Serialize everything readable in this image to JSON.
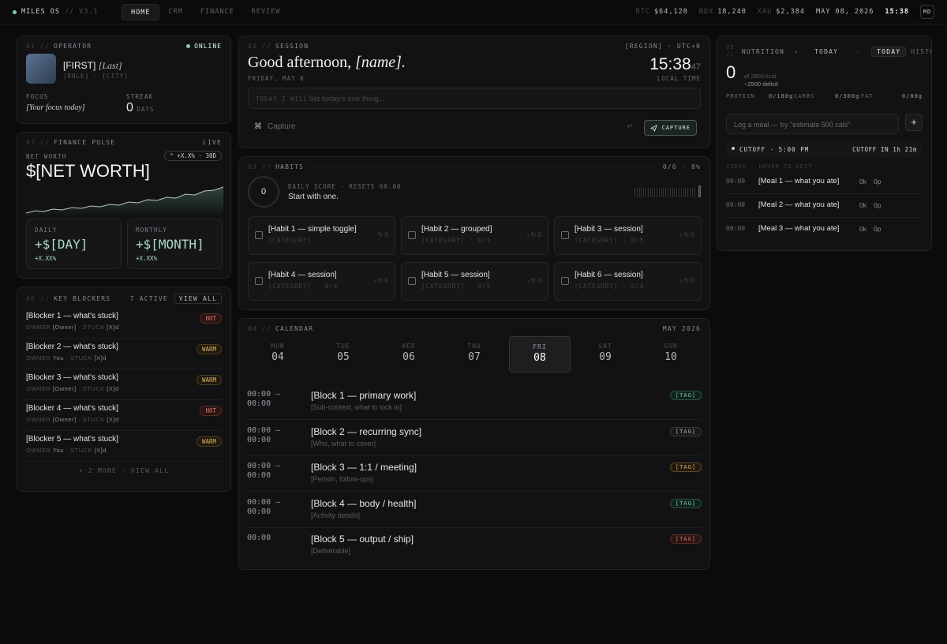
{
  "topbar": {
    "brand": "MILES OS",
    "version": "// V3.1",
    "tabs": [
      "HOME",
      "CRM",
      "FINANCE",
      "REVIEW"
    ],
    "active_tab": "HOME",
    "tickers": [
      {
        "sym": "BTC",
        "value": "$64,120"
      },
      {
        "sym": "NDX",
        "value": "18,240"
      },
      {
        "sym": "XAU",
        "value": "$2,384"
      }
    ],
    "date": "MAY 08, 2026",
    "time": "15:38",
    "user_initials": "MD"
  },
  "operator": {
    "num": "01 //",
    "title": "OPERATOR",
    "status": "ONLINE",
    "first": "[FIRST]",
    "last": "[Last]",
    "role_city": "[ROLE] · [CITY]",
    "focus_label": "FOCUS",
    "focus_value": "[Your focus today]",
    "streak_label": "STREAK",
    "streak_value": "0",
    "streak_unit": "DAYS"
  },
  "finance": {
    "num": "07 //",
    "title": "FINANCE PULSE",
    "live": "LIVE",
    "networth_label": "NET WORTH",
    "networth_value": "$[NET WORTH]",
    "change_badge": "^ +X.X% · 30D",
    "daily_label": "DAILY",
    "daily_value": "+$[DAY]",
    "daily_pct": "+X.XX%",
    "monthly_label": "MONTHLY",
    "monthly_value": "+$[MONTH]",
    "monthly_pct": "+X.XX%"
  },
  "blockers": {
    "num": "06 //",
    "title": "KEY BLOCKERS",
    "active": "7 ACTIVE",
    "view_all": "VIEW ALL",
    "more": "+ 2 MORE · VIEW ALL",
    "owner_label": "OWNER",
    "stuck_label": "· STUCK",
    "items": [
      {
        "title": "[Blocker 1 — what's stuck]",
        "owner": "[Owner]",
        "stuck": "[X]d",
        "tag": "HOT"
      },
      {
        "title": "[Blocker 2 — what's stuck]",
        "owner": "You",
        "stuck": "[X]d",
        "tag": "WARM"
      },
      {
        "title": "[Blocker 3 — what's stuck]",
        "owner": "[Owner]",
        "stuck": "[X]d",
        "tag": "WARM"
      },
      {
        "title": "[Blocker 4 — what's stuck]",
        "owner": "[Owner]",
        "stuck": "[X]d",
        "tag": "HOT"
      },
      {
        "title": "[Blocker 5 — what's stuck]",
        "owner": "You",
        "stuck": "[X]d",
        "tag": "WARM"
      }
    ]
  },
  "session": {
    "num": "02 //",
    "title": "SESSION",
    "region": "[REGION] · UTC+0",
    "greeting": "Good afternoon,",
    "name": "[name].",
    "date": "FRIDAY, MAY 8",
    "time_hm": "15:38",
    "time_s": "47",
    "local_time": "LOCAL TIME",
    "will_label": "TODAY I WILL",
    "will_placeholder": "Set today's one thing...",
    "capture_icon": "⌘",
    "capture_placeholder": "Capture",
    "capture_button": "CAPTURE"
  },
  "habits": {
    "num": "03 //",
    "title": "HABITS",
    "count": "0/6 · 0%",
    "score": "0",
    "score_label": "DAILY SCORE · RESETS 00:00",
    "score_hint": "Start with one.",
    "items": [
      {
        "title": "[Habit 1 — simple toggle]",
        "cat": "[CATEGORY]",
        "meta": "↻ 0"
      },
      {
        "title": "[Habit 2 — grouped]",
        "cat": "[CATEGORY] · 0/3",
        "meta": "› ↻ 0"
      },
      {
        "title": "[Habit 3 — session]",
        "cat": "[CATEGORY] · 0/5",
        "meta": "› ↻ 0"
      },
      {
        "title": "[Habit 4 — session]",
        "cat": "[CATEGORY] · 0/4",
        "meta": "› ↻ 0"
      },
      {
        "title": "[Habit 5 — session]",
        "cat": "[CATEGORY] · 0/5",
        "meta": "› ↻ 0"
      },
      {
        "title": "[Habit 6 — session]",
        "cat": "[CATEGORY] · 0/4",
        "meta": "› ↻ 0"
      }
    ]
  },
  "calendar": {
    "num": "04 //",
    "title": "CALENDAR",
    "month": "MAY 2026",
    "days": [
      {
        "dn": "MON",
        "dd": "04"
      },
      {
        "dn": "TUE",
        "dd": "05"
      },
      {
        "dn": "WED",
        "dd": "06"
      },
      {
        "dn": "THU",
        "dd": "07"
      },
      {
        "dn": "FRI",
        "dd": "08"
      },
      {
        "dn": "SAT",
        "dd": "09"
      },
      {
        "dn": "SUN",
        "dd": "10"
      }
    ],
    "selected_day": 4,
    "events": [
      {
        "time": "00:00 —\n00:00",
        "title": "[Block 1 — primary work]",
        "sub": "[Sub-context, what to lock in]",
        "tag": "[TAG]",
        "tag_color": "green"
      },
      {
        "time": "00:00 —\n00:00",
        "title": "[Block 2 — recurring sync]",
        "sub": "[Who, what to cover]",
        "tag": "[TAG]",
        "tag_color": "gray"
      },
      {
        "time": "00:00 —\n00:00",
        "title": "[Block 3 — 1:1 / meeting]",
        "sub": "[Person, follow-ups]",
        "tag": "[TAG]",
        "tag_color": "amber"
      },
      {
        "time": "00:00 —\n00:00",
        "title": "[Block 4 — body / health]",
        "sub": "[Activity details]",
        "tag": "[TAG]",
        "tag_color": "green"
      },
      {
        "time": "00:00",
        "title": "[Block 5 — output / ship]",
        "sub": "[Deliverable]",
        "tag": "[TAG]",
        "tag_color": "red"
      }
    ]
  },
  "nutrition": {
    "num": "05 //",
    "title": "NUTRITION",
    "prev": "‹",
    "today_nav": "TODAY",
    "sep": "›",
    "tab_today": "TODAY",
    "tab_history": "HISTO",
    "kcal": "0",
    "kcal_of": "of 2800 kcal",
    "deficit": "~2500 deficit",
    "protein_label": "PROTEIN",
    "protein_value": "0/180g",
    "carbs_label": "CARBS",
    "carbs_value": "0/300g",
    "fat_label": "FAT",
    "fat_value": "0/80g",
    "log_placeholder": "Log a meal — try \"estimate 500 cals\"",
    "add": "+",
    "cutoff": "CUTOFF · 5:00 PM",
    "cutoff_in": "CUTOFF IN 1h 21m",
    "today_hint": "TODAY · HOVER TO EDIT",
    "meals": [
      {
        "time": "00:00",
        "title": "[Meal 1 — what you ate]",
        "k": "0k",
        "p": "0p"
      },
      {
        "time": "00:00",
        "title": "[Meal 2 — what you ate]",
        "k": "0k",
        "p": "0p"
      },
      {
        "time": "00:00",
        "title": "[Meal 3 — what you ate]",
        "k": "0k",
        "p": "0p"
      }
    ]
  }
}
